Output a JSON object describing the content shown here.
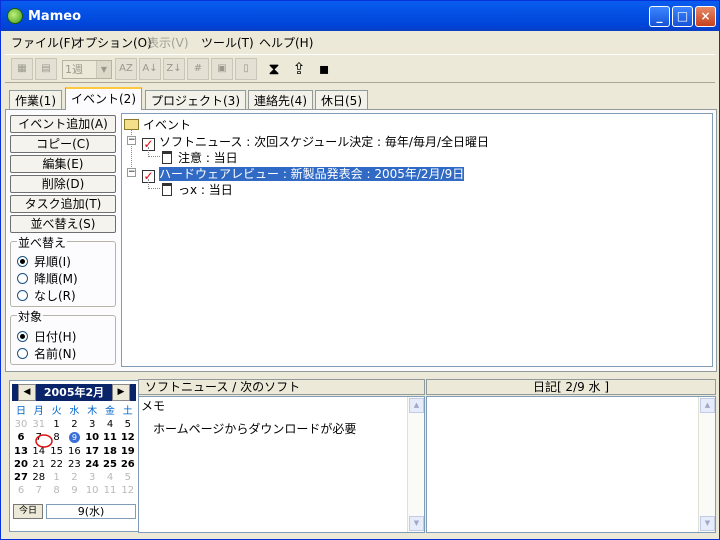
{
  "window": {
    "title": "Mameo"
  },
  "menu": [
    "ファイル(F)",
    "オプション(O)",
    "表示(V)",
    "ツール(T)",
    "ヘルプ(H)"
  ],
  "toolbar": {
    "week_combo": "1週"
  },
  "tabs": [
    "作業(1)",
    "イベント(2)",
    "プロジェクト(3)",
    "連絡先(4)",
    "休日(5)"
  ],
  "buttons": [
    "イベント追加(A)",
    "コピー(C)",
    "編集(E)",
    "削除(D)",
    "タスク追加(T)",
    "並べ替え(S)"
  ],
  "sort_group": {
    "label": "並べ替え",
    "options": [
      "昇順(I)",
      "降順(M)",
      "なし(R)"
    ],
    "selected": 0
  },
  "target_group": {
    "label": "対象",
    "options": [
      "日付(H)",
      "名前(N)"
    ],
    "selected": 0
  },
  "tree": {
    "root": "イベント",
    "items": [
      {
        "text": "ソフトニュース : 次回スケジュール決定 : 毎年/毎月/全日曜日",
        "child": "注意 : 当日",
        "selected": false
      },
      {
        "text": "ハードウェアレビュー : 新製品発表会 : 2005年/2月/9日",
        "child": "っx : 当日",
        "selected": true
      }
    ]
  },
  "calendar": {
    "month_label": "2005年2月",
    "weekdays": [
      "日",
      "月",
      "火",
      "水",
      "木",
      "金",
      "土"
    ],
    "weeks": [
      [
        "30",
        "31",
        "1",
        "2",
        "3",
        "4",
        "5"
      ],
      [
        "6",
        "7",
        "8",
        "9",
        "10",
        "11",
        "12"
      ],
      [
        "13",
        "14",
        "15",
        "16",
        "17",
        "18",
        "19"
      ],
      [
        "20",
        "21",
        "22",
        "23",
        "24",
        "25",
        "26"
      ],
      [
        "27",
        "28",
        "1",
        "2",
        "3",
        "4",
        "5"
      ],
      [
        "6",
        "7",
        "8",
        "9",
        "10",
        "11",
        "12"
      ]
    ],
    "today_label": "今日",
    "selected_date": "9(水)"
  },
  "memo": {
    "header": "ソフトニュース / 次のソフト",
    "label": "メモ",
    "body": "ホームページからダウンロードが必要"
  },
  "diary": {
    "header": "日記[ 2/9 水 ]"
  }
}
